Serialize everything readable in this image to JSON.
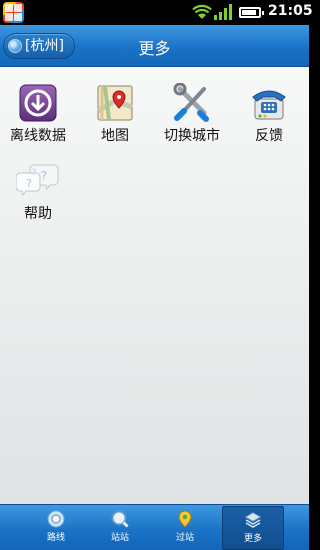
{
  "status_bar": {
    "time": "21:05",
    "battery_level": 0.85
  },
  "header": {
    "city_button": "[杭州]",
    "title": "更多"
  },
  "tiles": [
    {
      "label": "离线数据",
      "icon": "download-icon"
    },
    {
      "label": "地图",
      "icon": "map-icon"
    },
    {
      "label": "切换城市",
      "icon": "tools-icon"
    },
    {
      "label": "反馈",
      "icon": "telephone-icon"
    },
    {
      "label": "帮助",
      "icon": "help-icon"
    }
  ],
  "bottom_nav": [
    {
      "label": "路线",
      "icon": "route-icon",
      "active": false
    },
    {
      "label": "站站",
      "icon": "station-search-icon",
      "active": false
    },
    {
      "label": "过站",
      "icon": "pin-icon",
      "active": false
    },
    {
      "label": "更多",
      "icon": "more-icon",
      "active": true
    }
  ],
  "colors": {
    "header_blue": "#1a73c7",
    "content_bg": "#eceeee"
  }
}
